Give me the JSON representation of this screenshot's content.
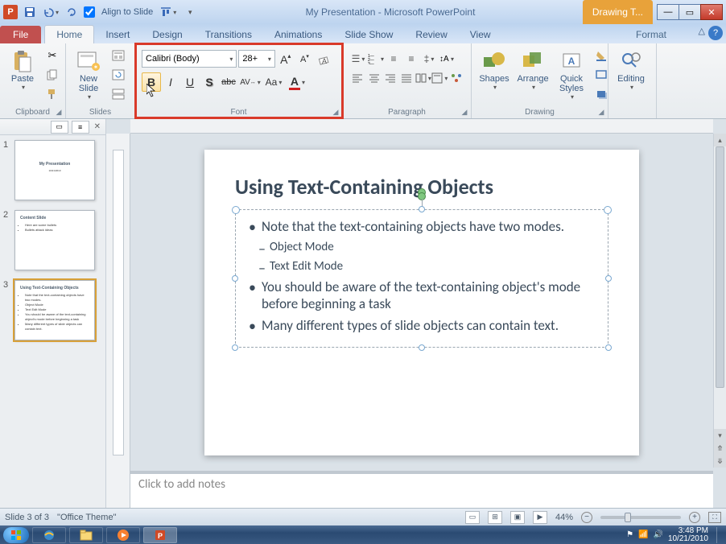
{
  "titlebar": {
    "align_label": "Align to Slide",
    "title": "My Presentation  -  Microsoft PowerPoint",
    "context_label": "Drawing T..."
  },
  "tabs": {
    "file": "File",
    "items": [
      "Home",
      "Insert",
      "Design",
      "Transitions",
      "Animations",
      "Slide Show",
      "Review",
      "View"
    ],
    "context": "Format"
  },
  "ribbon": {
    "clipboard": {
      "label": "Clipboard",
      "paste": "Paste"
    },
    "slides": {
      "label": "Slides",
      "new_slide": "New\nSlide"
    },
    "font": {
      "label": "Font",
      "name": "Calibri (Body)",
      "size": "28+"
    },
    "paragraph": {
      "label": "Paragraph"
    },
    "drawing": {
      "label": "Drawing",
      "shapes": "Shapes",
      "arrange": "Arrange",
      "quick": "Quick\nStyles"
    },
    "editing": {
      "label": "Editing",
      "btn": "Editing"
    }
  },
  "panel": {
    "slides": [
      {
        "num": "1",
        "title": "My Presentation",
        "lines": [
          "10/21/2010"
        ]
      },
      {
        "num": "2",
        "title": "Content Slide",
        "lines": [
          "Here are some bullets",
          "Bullets attack ideas"
        ]
      },
      {
        "num": "3",
        "title": "Using Text-Containing Objects",
        "lines": [
          "Note that the text-containing objects have two modes.",
          "Object Mode",
          "Text Edit Mode",
          "You should be aware of the text-containing object's mode before beginning a task",
          "Many different types of slide objects can contain text."
        ]
      }
    ]
  },
  "slide": {
    "title": "Using Text-Containing Objects",
    "bullets": [
      {
        "text": "Note that the text-containing objects have two modes.",
        "sub": [
          "Object Mode",
          "Text Edit Mode"
        ]
      },
      {
        "text": "You should be aware of the text-containing object's mode before beginning a task"
      },
      {
        "text": "Many different types of slide objects can contain text."
      }
    ]
  },
  "notes_placeholder": "Click to add notes",
  "status": {
    "slide_info": "Slide 3 of 3",
    "theme": "\"Office Theme\"",
    "zoom": "44%"
  },
  "tray": {
    "time": "3:48 PM",
    "date": "10/21/2010"
  }
}
